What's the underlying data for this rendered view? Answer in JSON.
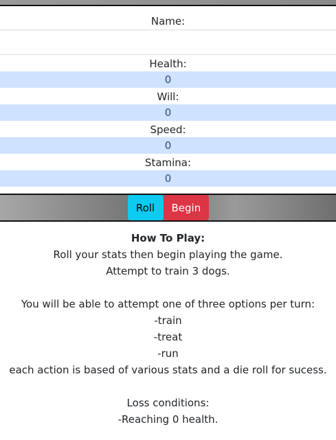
{
  "form": {
    "name_label": "Name:",
    "name_value": ""
  },
  "stats": [
    {
      "label": "Health:",
      "value": "0"
    },
    {
      "label": "Will:",
      "value": "0"
    },
    {
      "label": "Speed:",
      "value": "0"
    },
    {
      "label": "Stamina:",
      "value": "0"
    }
  ],
  "actions": {
    "roll_label": "Roll",
    "begin_label": "Begin"
  },
  "how_to_play": {
    "title": "How To Play:",
    "lines": [
      "Roll your stats then begin playing the game.",
      "Attempt to train 3 dogs.",
      "",
      "You will be able to attempt one of three options per turn:",
      "-train",
      "-treat",
      "-run",
      "each action is based of various stats and a die roll for sucess.",
      "",
      "Loss conditions:",
      "-Reaching 0 health."
    ]
  },
  "colors": {
    "roll_button": "#0dcaf0",
    "begin_button": "#dc3545",
    "stat_value_bg": "#cfe2ff"
  }
}
